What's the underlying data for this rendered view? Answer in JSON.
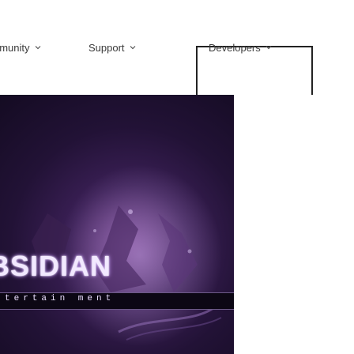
{
  "nav": {
    "items": [
      {
        "label": "nmunity",
        "icon": "chevron-down-icon"
      },
      {
        "label": "Support",
        "icon": "chevron-down-icon"
      },
      {
        "label": "Developers",
        "icon": "chevron-down-icon"
      }
    ]
  },
  "hero": {
    "logo_text": "BSIDIAN",
    "tagline": "tertain ment"
  },
  "colors": {
    "nav_text": "#3a3a3a",
    "highlight_border": "#222222",
    "banner_dark": "#140b22",
    "banner_purple": "#6b3a84"
  }
}
